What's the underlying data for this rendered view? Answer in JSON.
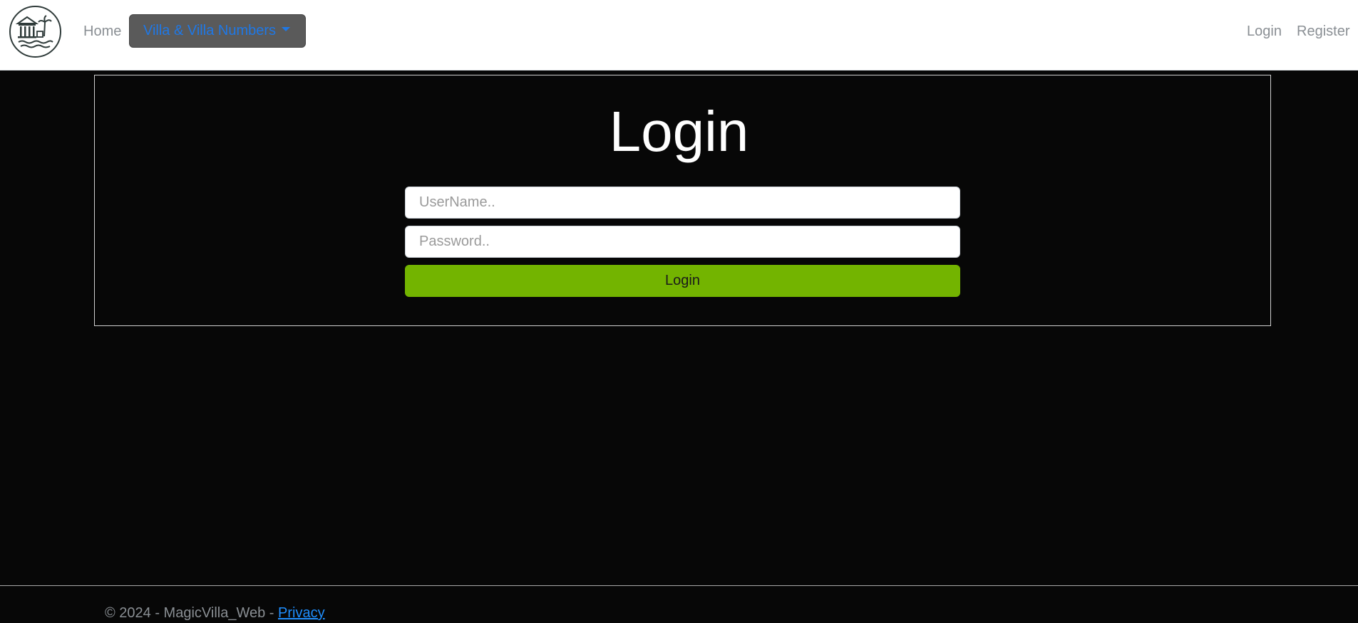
{
  "navbar": {
    "home_label": "Home",
    "dropdown_label": "Villa & Villa Numbers",
    "login_label": "Login",
    "register_label": "Register",
    "logo_icon": "villa-logo-icon"
  },
  "main": {
    "title": "Login",
    "username_placeholder": "UserName..",
    "password_placeholder": "Password..",
    "login_button_label": "Login"
  },
  "footer": {
    "copyright": "© 2024 - MagicVilla_Web - ",
    "privacy_label": "Privacy"
  },
  "colors": {
    "background": "#070707",
    "accent_green": "#73b400",
    "dropdown_bg": "#5a5a5a",
    "link_blue": "#1f78e6"
  }
}
